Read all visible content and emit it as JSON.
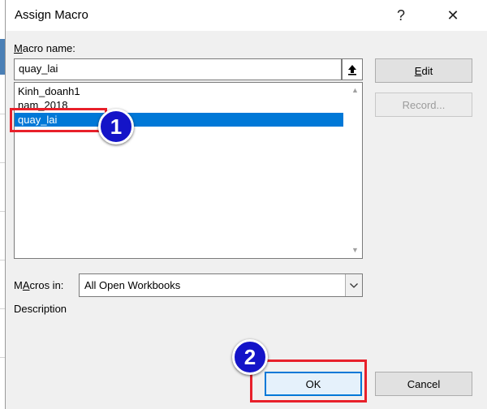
{
  "dialog": {
    "title": "Assign Macro",
    "help_glyph": "?",
    "close_glyph": "✕"
  },
  "macro_name": {
    "label_prefix": "",
    "label_underlined": "M",
    "label_rest": "acro name:",
    "value": "quay_lai"
  },
  "macro_list": {
    "items": [
      "Kinh_doanh1",
      "nam_2018",
      "quay_lai"
    ],
    "selected": "quay_lai"
  },
  "buttons": {
    "edit_underlined": "E",
    "edit_rest": "dit",
    "record": "Record...",
    "ok": "OK",
    "cancel": "Cancel"
  },
  "macros_in": {
    "label_underlined": "A",
    "label_prefix": "M",
    "label_rest": "cros in:",
    "value": "All Open Workbooks"
  },
  "description": {
    "label": "Description"
  },
  "annotations": {
    "step1": "1",
    "step2": "2",
    "highlight_color": "#e8202a",
    "badge_color": "#1414c8"
  }
}
